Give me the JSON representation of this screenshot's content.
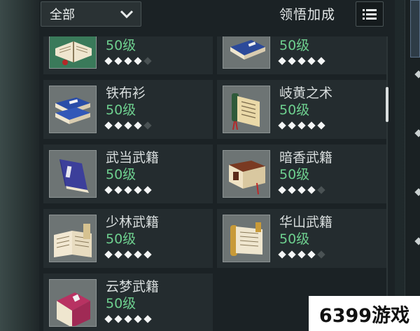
{
  "toolbar": {
    "filter_label": "全部",
    "bonus_label": "领悟加成"
  },
  "cards": [
    {
      "name": "",
      "level": "50级",
      "stars": 4,
      "total": 5,
      "book": "green-open"
    },
    {
      "name": "",
      "level": "50级",
      "stars": 5,
      "total": 5,
      "book": "blue-stack"
    },
    {
      "name": "铁布衫",
      "level": "50级",
      "stars": 4,
      "total": 5,
      "book": "blue-stack"
    },
    {
      "name": "岐黄之术",
      "level": "50级",
      "stars": 5,
      "total": 5,
      "book": "scroll-green"
    },
    {
      "name": "武当武籍",
      "level": "50级",
      "stars": 5,
      "total": 5,
      "book": "purple"
    },
    {
      "name": "暗香武籍",
      "level": "50级",
      "stars": 4,
      "total": 5,
      "book": "red-tassel"
    },
    {
      "name": "少林武籍",
      "level": "50级",
      "stars": 5,
      "total": 5,
      "book": "open-cream"
    },
    {
      "name": "华山武籍",
      "level": "50级",
      "stars": 4,
      "total": 5,
      "book": "scroll-gold"
    },
    {
      "name": "云梦武籍",
      "level": "50级",
      "stars": 5,
      "total": 5,
      "book": "pink"
    }
  ],
  "watermark": "6399游戏",
  "colors": {
    "level_green": "#6ed08f",
    "star_on": "#f4f6f6",
    "star_off": "#4a5254"
  }
}
